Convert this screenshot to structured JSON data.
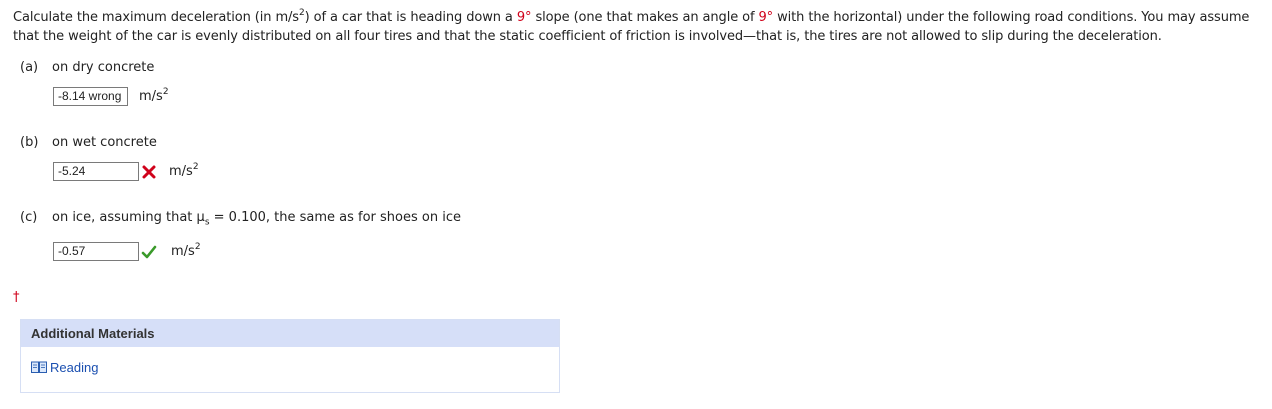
{
  "question": {
    "text_1": "Calculate the maximum deceleration (in m/s",
    "sup_1": "2",
    "text_2": ") of a car that is heading down a ",
    "angle_1": "9°",
    "text_3": " slope (one that makes an angle of ",
    "angle_2": "9°",
    "text_4": " with the horizontal) under the following road conditions. You may assume that the weight of the car is evenly distributed on all four tires and that the static coefficient of friction is involved—that is, the tires are not allowed to slip during the deceleration."
  },
  "parts": [
    {
      "letter": "(a)",
      "label": "on dry concrete",
      "answer": "-8.14 wrong",
      "unit": "m/s",
      "unit_sup": "2",
      "status": "submitted"
    },
    {
      "letter": "(b)",
      "label": "on wet concrete",
      "answer": "-5.24",
      "unit": "m/s",
      "unit_sup": "2",
      "status": "incorrect",
      "status_icon": "red-x-icon"
    },
    {
      "letter": "(c)",
      "label_pre": "on ice, assuming that μ",
      "label_sub": "s",
      "label_post": " = 0.100, the same as for shoes on ice",
      "answer": "-0.57",
      "unit": "m/s",
      "unit_sup": "2",
      "status": "correct",
      "status_icon": "green-check-icon"
    }
  ],
  "dagger": "†",
  "materials": {
    "header": "Additional Materials",
    "link_label": "Reading",
    "link_icon": "book-icon"
  },
  "colors": {
    "accent_red": "#d0021b",
    "header_bg": "#d6dff8",
    "link_blue": "#1a4fb0",
    "check_green": "#3a9a2a"
  }
}
